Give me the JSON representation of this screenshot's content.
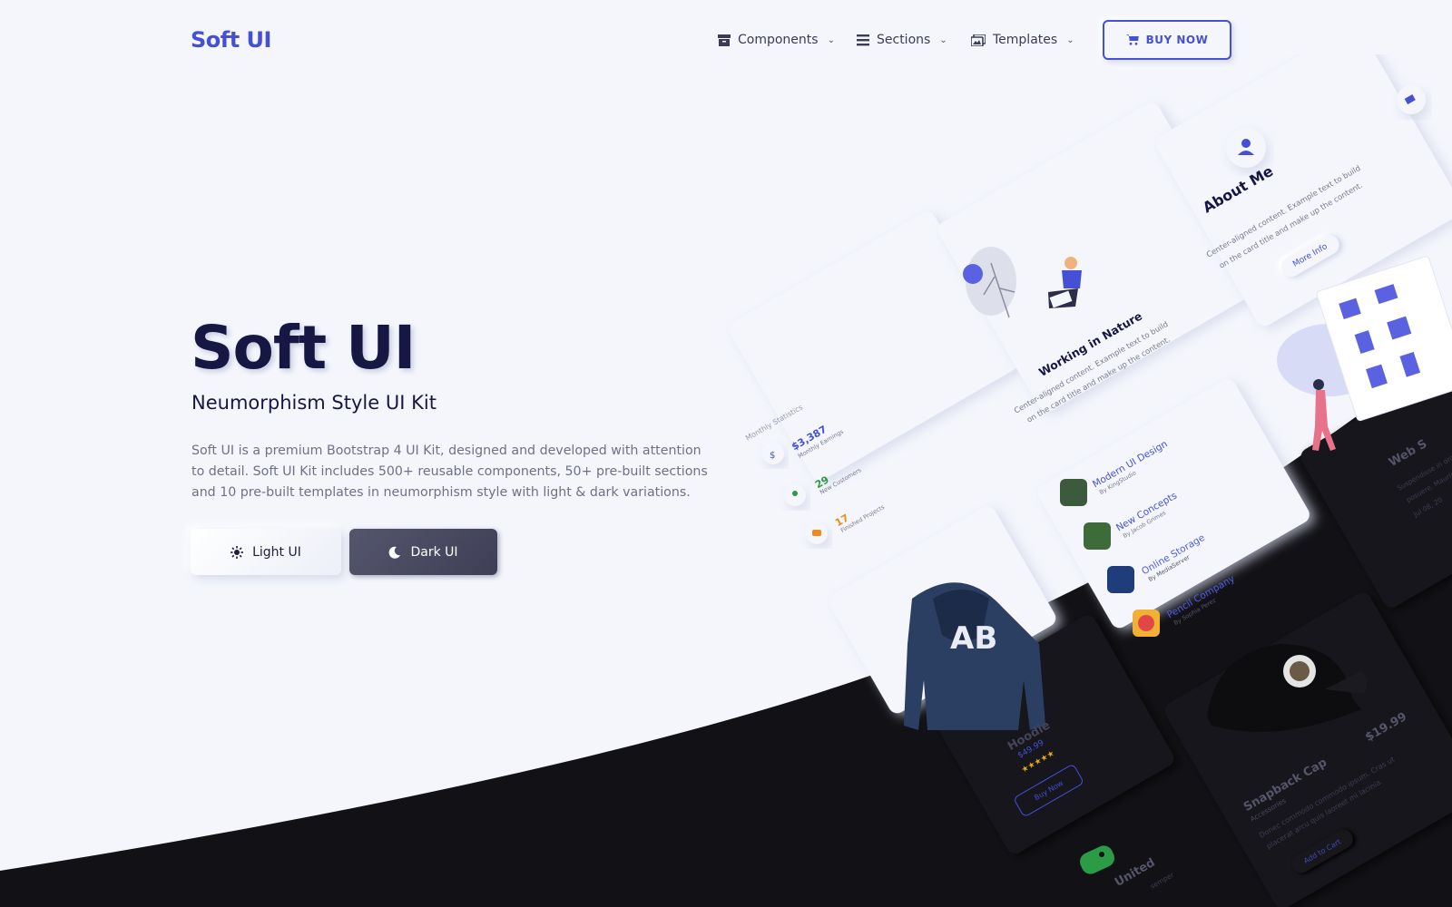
{
  "brand": "Soft UI",
  "nav": {
    "items": [
      {
        "label": "Components",
        "icon": "archive-icon"
      },
      {
        "label": "Sections",
        "icon": "list-icon"
      },
      {
        "label": "Templates",
        "icon": "images-icon"
      }
    ],
    "buy_now": "BUY NOW"
  },
  "hero": {
    "title": "Soft UI",
    "subtitle": "Neumorphism Style UI Kit",
    "description": "Soft UI is a premium Bootstrap 4 UI Kit, designed and developed with attention to detail. Soft UI Kit includes 500+ reusable components, 50+ pre-built sections and 10 pre-built templates in neumorphism style with light & dark variations.",
    "light_button": "Light UI",
    "dark_button": "Dark UI"
  },
  "showcase": {
    "about": {
      "title": "About Me",
      "text1": "Center-aligned content. Example text to build",
      "text2": "on the card title and make up the content.",
      "button": "More Info"
    },
    "nature": {
      "title": "Working in Nature",
      "text1": "Center-aligned content. Example text to build",
      "text2": "on the card title and make up the content."
    },
    "stats": {
      "title": "Monthly Statistics",
      "rows": [
        {
          "value": "$3,387",
          "label": "Monthly Earnings"
        },
        {
          "value": "29",
          "label": "New Customers"
        },
        {
          "value": "17",
          "label": "Finished Projects"
        }
      ]
    },
    "projects": [
      {
        "title": "Modern UI Design",
        "by": "By KingStudio"
      },
      {
        "title": "New Concepts",
        "by": "By Jacob Grimes"
      },
      {
        "title": "Online Storage",
        "by": "By MediaServer"
      },
      {
        "title": "Pencil Company",
        "by": "By Sophia Perez"
      }
    ],
    "hoodie": {
      "name": "Hoodie",
      "price": "$49.99",
      "stars": "★★★★★",
      "button": "Buy Now"
    },
    "cap": {
      "name": "Snapback Cap",
      "category": "Accessories",
      "price": "$19.99",
      "text1": "Donec commodo commodo ipsum. Cras ut",
      "text2": "placerat arcu quis laoreet mi lacinia.",
      "button": "Add to Cart"
    },
    "web": {
      "title": "Web S",
      "text1": "Suspendisse in orci",
      "text2": "posuere. Mauris",
      "date": "Jul 08, 20"
    },
    "game": {
      "title": "United",
      "text": "semper"
    }
  }
}
